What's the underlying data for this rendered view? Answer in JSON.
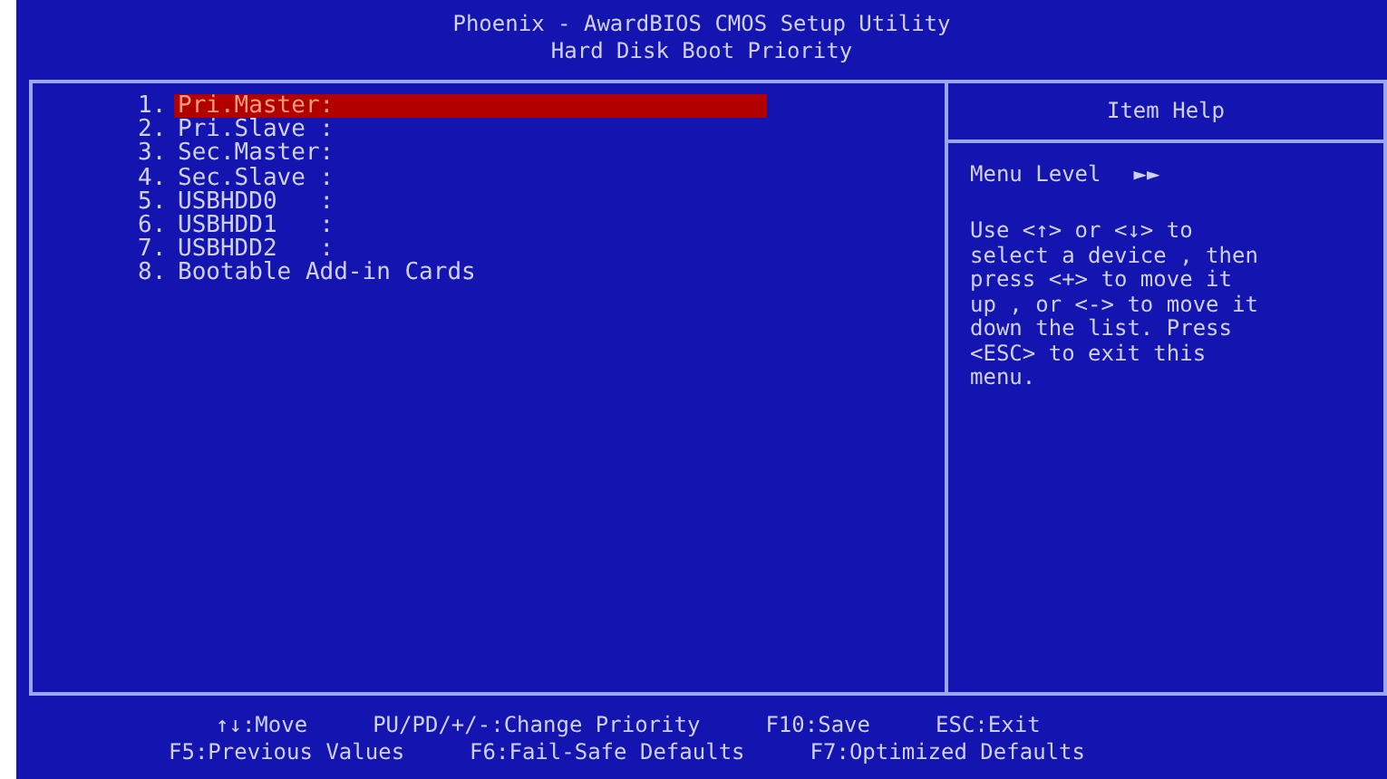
{
  "header": {
    "title": "Phoenix - AwardBIOS CMOS Setup Utility",
    "subtitle": "Hard Disk Boot Priority"
  },
  "boot_list": [
    {
      "number": "1.",
      "label": "Pri.Master:",
      "selected": true
    },
    {
      "number": "2.",
      "label": "Pri.Slave :",
      "selected": false
    },
    {
      "number": "3.",
      "label": "Sec.Master:",
      "selected": false
    },
    {
      "number": "4.",
      "label": "Sec.Slave :",
      "selected": false
    },
    {
      "number": "5.",
      "label": "USBHDD0   :",
      "selected": false
    },
    {
      "number": "6.",
      "label": "USBHDD1   :",
      "selected": false
    },
    {
      "number": "7.",
      "label": "USBHDD2   :",
      "selected": false
    },
    {
      "number": "8.",
      "label": "Bootable Add-in Cards",
      "selected": false
    }
  ],
  "item_help": {
    "title": "Item Help",
    "menu_level_label": "Menu Level",
    "menu_level_marker": "►►",
    "text_lines": [
      "Use <↑> or <↓> to",
      "select a device , then",
      "press <+> to move it",
      "up , or <-> to move it",
      "down the list. Press",
      "<ESC> to exit this",
      "menu."
    ]
  },
  "footer": [
    [
      "↑↓:Move",
      "PU/PD/+/-:Change Priority",
      "F10:Save",
      "ESC:Exit"
    ],
    [
      "F5:Previous Values",
      "F6:Fail-Safe Defaults",
      "F7:Optimized Defaults"
    ]
  ]
}
